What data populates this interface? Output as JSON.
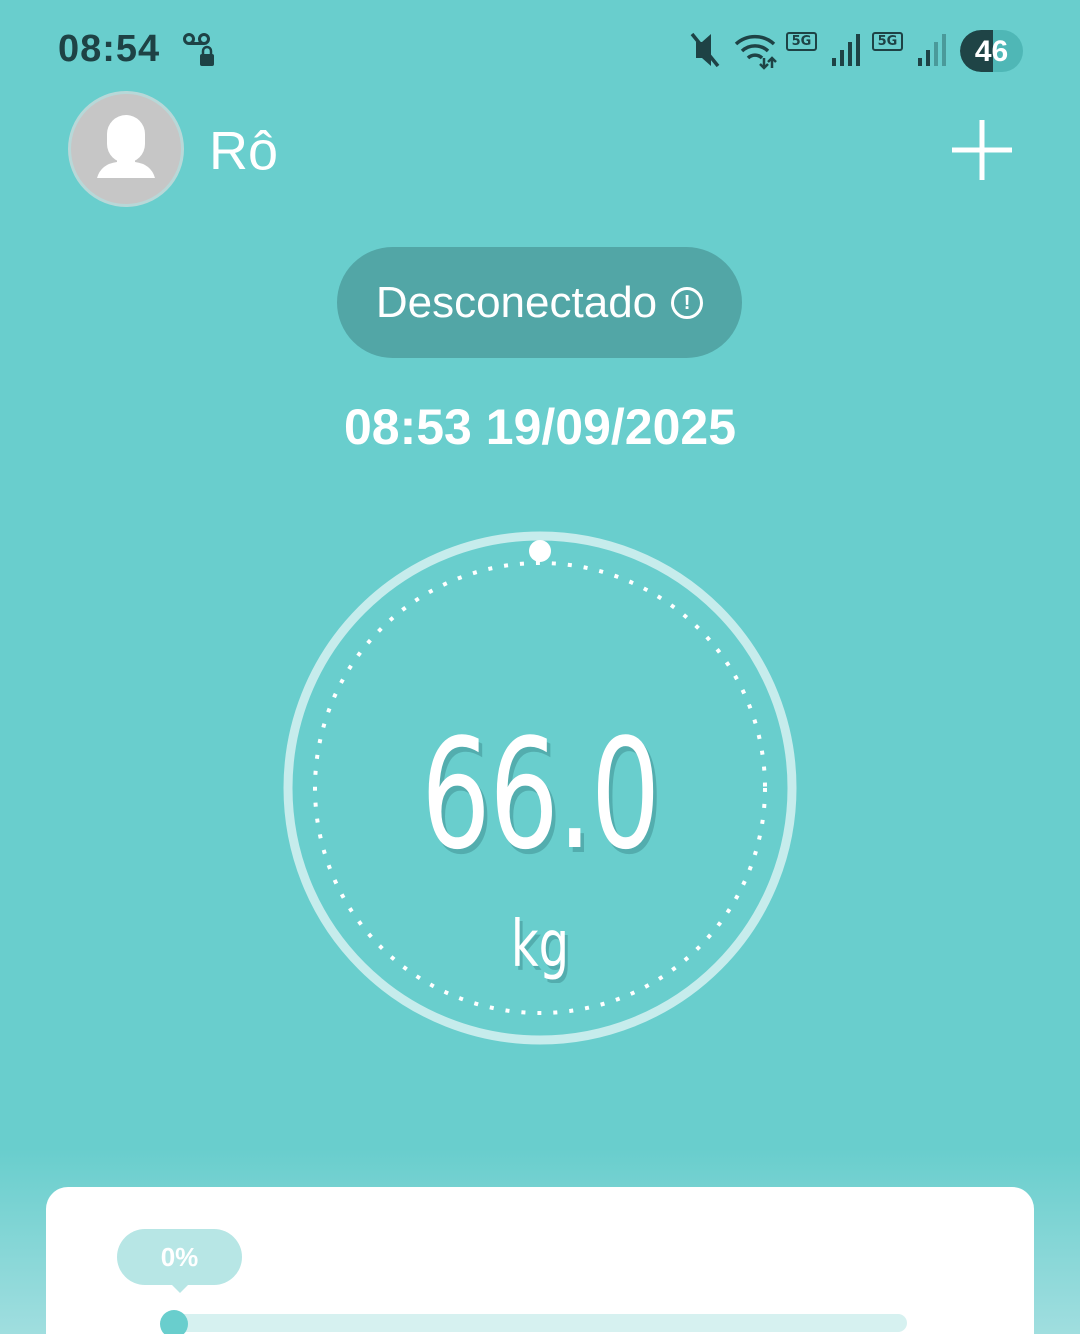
{
  "status_bar": {
    "time": "08:54",
    "left_icon": "voicemail-lock-icon",
    "icons": [
      "mute-icon",
      "wifi-icon",
      "5g-icon",
      "signal-icon",
      "5g-icon",
      "signal-weak-icon"
    ],
    "network_badge_1": "5G",
    "network_badge_2": "5G",
    "battery": "46"
  },
  "header": {
    "avatar_icon": "user-silhouette-icon",
    "user_name": "Rô",
    "add_icon": "plus-icon"
  },
  "connection": {
    "status": "Desconectado",
    "icon": "info-circle-icon",
    "icon_glyph": "!"
  },
  "measurement": {
    "datetime": "08:53 19/09/2025",
    "weight": "66.0",
    "unit": "kg"
  },
  "progress": {
    "label": "0%",
    "value": 0
  },
  "colors": {
    "background": "#69cecd",
    "pill": "#52a6a6",
    "status_text": "#1e4245",
    "card": "#ffffff",
    "track": "#d6f1f0"
  }
}
